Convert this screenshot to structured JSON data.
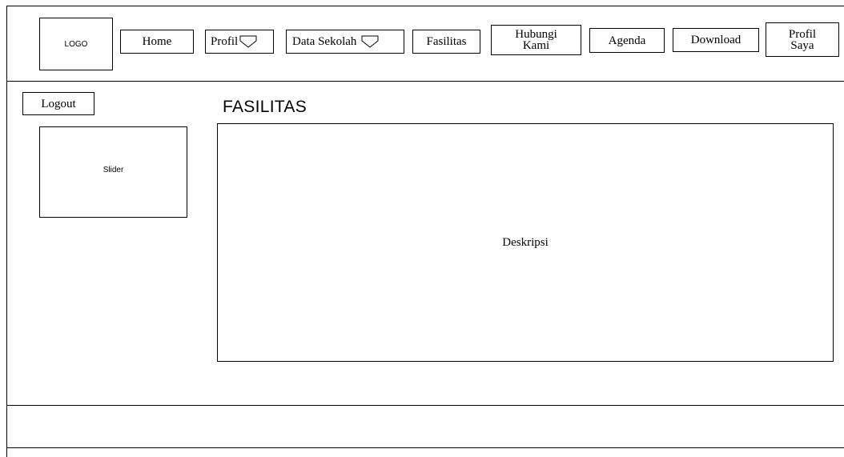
{
  "header": {
    "logo": "LOGO",
    "nav": {
      "home": "Home",
      "profil": "Profil",
      "data_sekolah": "Data Sekolah",
      "fasilitas": "Fasilitas",
      "hubungi_line1": "Hubungi",
      "hubungi_line2": "Kami",
      "agenda": "Agenda",
      "download": "Download",
      "profil_saya_line1": "Profil",
      "profil_saya_line2": "Saya"
    }
  },
  "sidebar": {
    "logout": "Logout",
    "slider": "Slider"
  },
  "main": {
    "title": "FASILITAS",
    "description": "Deskripsi"
  },
  "icons": {
    "dropdown": "chevron-down-icon"
  }
}
